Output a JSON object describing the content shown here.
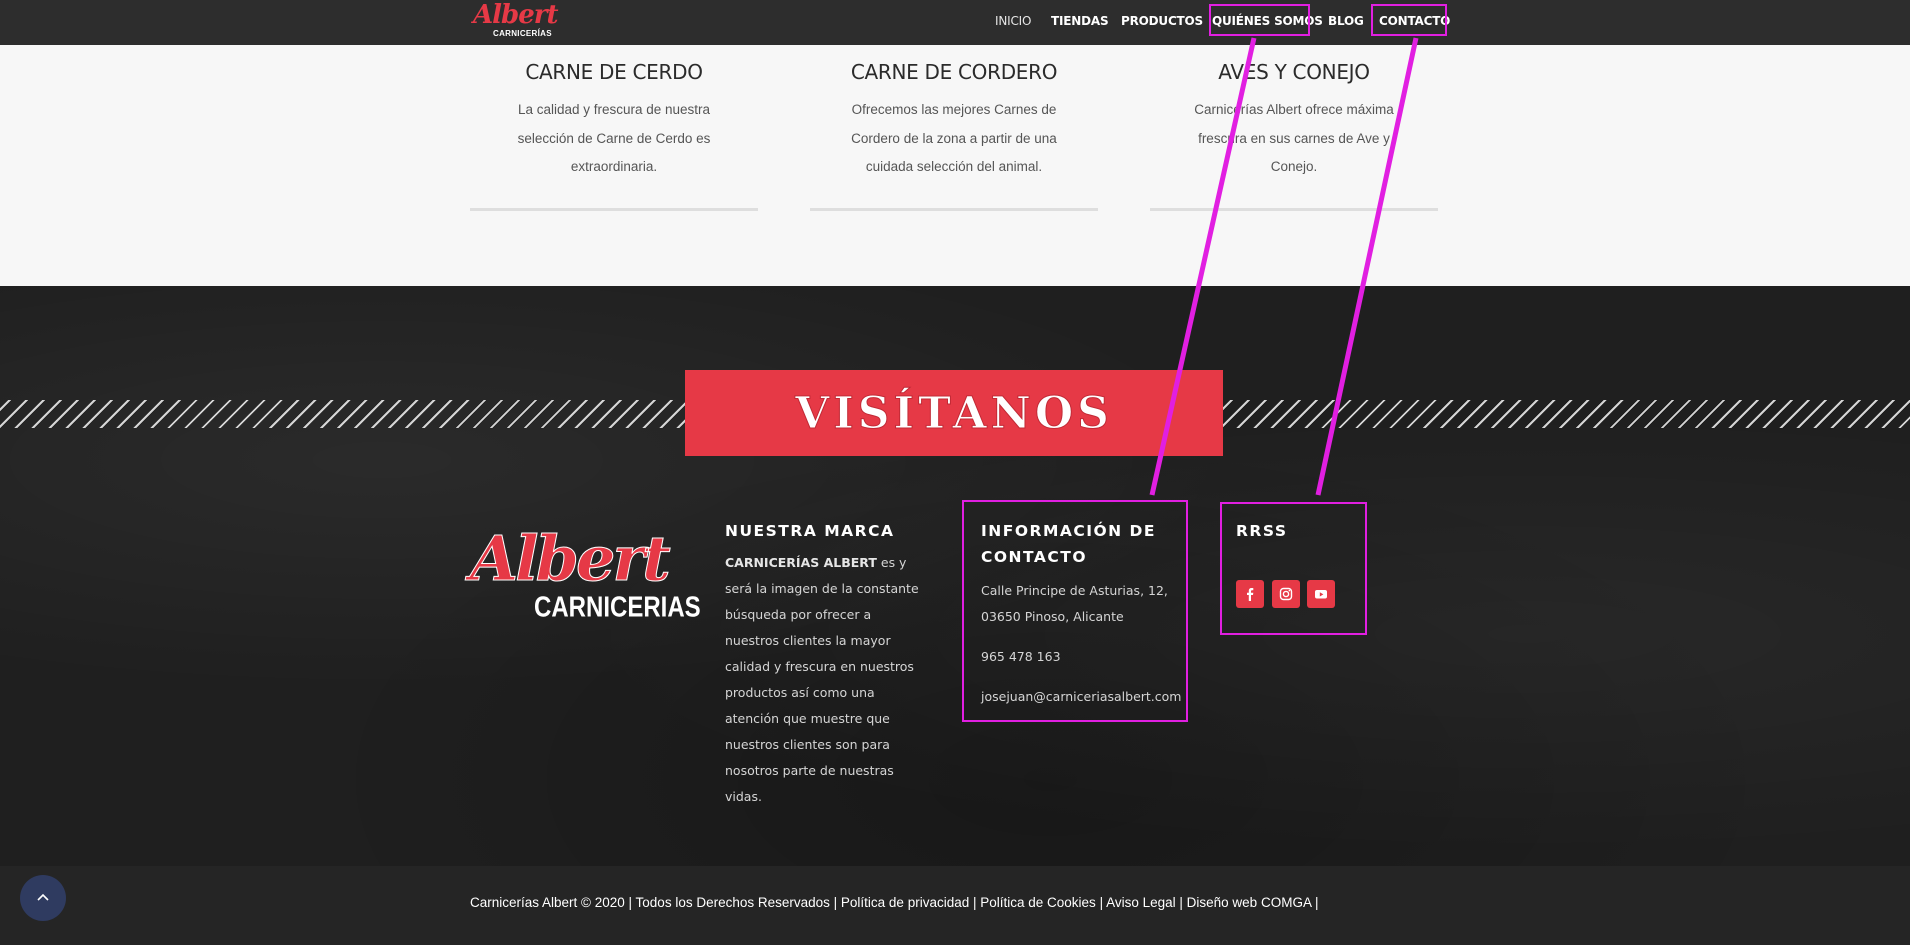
{
  "nav": {
    "logo_script": "Albert",
    "logo_sub": "CARNICERÍAS",
    "items": [
      "INICIO",
      "TIENDAS",
      "PRODUCTOS",
      "QUIÉNES SOMOS",
      "BLOG",
      "CONTACTO"
    ]
  },
  "cards": [
    {
      "title": "CARNE DE CERDO",
      "desc": "La calidad y frescura de nuestra selección de Carne de Cerdo es extraordinaria."
    },
    {
      "title": "CARNE DE CORDERO",
      "desc": "Ofrecemos las mejores Carnes de Cordero de la zona a partir de una cuidada selección del animal."
    },
    {
      "title": "AVES Y CONEJO",
      "desc": "Carnicerías Albert ofrece máxima frescura en sus carnes de Ave y Conejo."
    }
  ],
  "banner": {
    "text": "VISÍTANOS"
  },
  "footer_logo": {
    "script": "Albert",
    "sub": "CARNICERIAS"
  },
  "marca": {
    "title": "NUESTRA MARCA",
    "brand": "CARNICERÍAS ALBERT",
    "text": " es y será la imagen de la constante búsqueda por ofrecer a nuestros clientes la mayor calidad y frescura en nuestros productos así como una atención que muestre que nuestros clientes son para nosotros parte de nuestras vidas."
  },
  "contacto": {
    "title": "INFORMACIÓN DE CONTACTO",
    "address": "Calle Principe de Asturias, 12, 03650 Pinoso, Alicante",
    "phone": "965 478 163",
    "email": "josejuan@carniceriasalbert.com"
  },
  "rrss": {
    "title": "RRSS",
    "icons": [
      "facebook-icon",
      "instagram-icon",
      "youtube-icon"
    ]
  },
  "bottom": {
    "copyright": "Carnicerías Albert © 2020 | Todos los Derechos Reservados | ",
    "privacy": "Política de privacidad",
    "cookies": "Política de Cookies",
    "legal": "Aviso Legal",
    "design": "Diseño web COMGA",
    "sep": " | "
  },
  "colors": {
    "accent": "#e63946",
    "highlight": "#e11fe1",
    "dark": "#2d2d2d"
  }
}
